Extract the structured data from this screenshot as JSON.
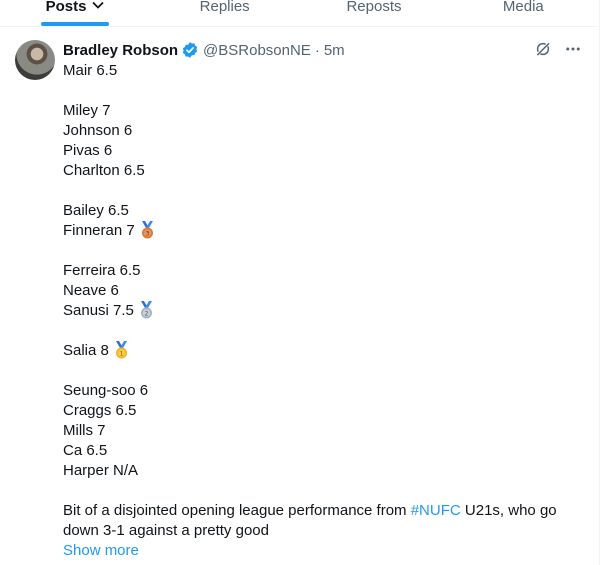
{
  "tabs": [
    {
      "label": "Posts",
      "active": true
    },
    {
      "label": "Replies",
      "active": false
    },
    {
      "label": "Reposts",
      "active": false
    },
    {
      "label": "Media",
      "active": false
    }
  ],
  "tweet": {
    "author_name": "Bradley Robson",
    "handle": "@BSRobsonNE",
    "separator": "·",
    "time": "5m",
    "lines": {
      "l1": "Mair 6.5",
      "l2": "Miley 7",
      "l3": "Johnson 6",
      "l4": "Pivas 6",
      "l5": "Charlton 6.5",
      "l6": "Bailey 6.5",
      "l7": "Finneran 7",
      "l8": "Ferreira 6.5",
      "l9": "Neave 6",
      "l10": "Sanusi 7.5",
      "l11": "Salia 8",
      "l12": "Seung-soo 6",
      "l13": "Craggs 6.5",
      "l14": "Mills 7",
      "l15": "Ca 6.5",
      "l16": "Harper N/A"
    },
    "paragraph_pre": "Bit of a disjointed opening league performance from ",
    "hashtag": "#NUFC",
    "paragraph_post": " U21s, who go down 3-1 against a pretty good",
    "show_more": "Show more"
  },
  "icons": {
    "verified": "verified-badge-icon",
    "grok": "grok-icon",
    "more": "more-icon",
    "medal_bronze": "third-place-medal-icon",
    "medal_silver": "second-place-medal-icon",
    "medal_gold": "first-place-medal-icon"
  },
  "colors": {
    "accent": "#1d9bf0",
    "text": "#0f1419",
    "muted": "#536471"
  }
}
